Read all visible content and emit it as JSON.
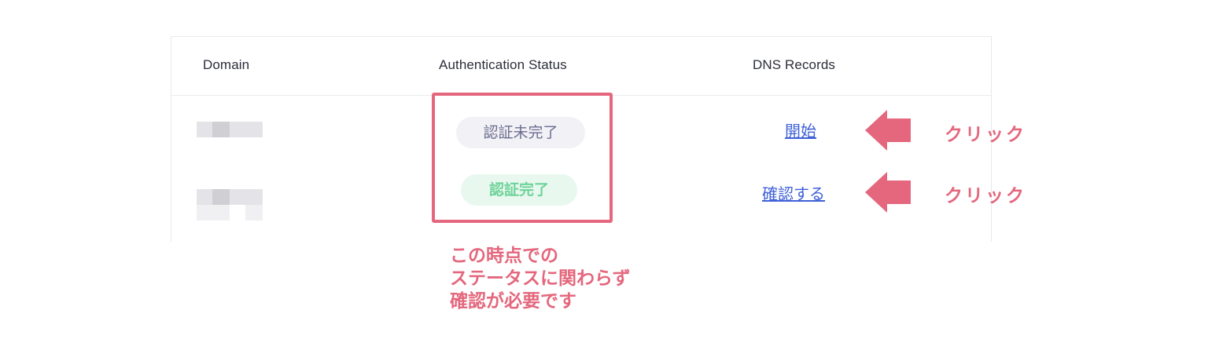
{
  "table": {
    "headers": {
      "domain": "Domain",
      "auth_status": "Authentication Status",
      "dns_records": "DNS Records"
    },
    "rows": [
      {
        "domain": "",
        "status": "認証未完了",
        "status_type": "pending",
        "action": "開始"
      },
      {
        "domain": "",
        "status": "認証完了",
        "status_type": "complete",
        "action": "確認する"
      }
    ]
  },
  "annotations": {
    "click_label": "クリック",
    "note_lines": [
      "この時点での",
      "ステータスに関わらず",
      "確認が必要です"
    ],
    "accent_color": "#e4677d"
  },
  "colors": {
    "pending_bg": "#f1f1f6",
    "pending_text": "#6b6c8f",
    "complete_bg": "#e8f8ef",
    "complete_text": "#6fd39a",
    "link": "#3f61d8"
  }
}
